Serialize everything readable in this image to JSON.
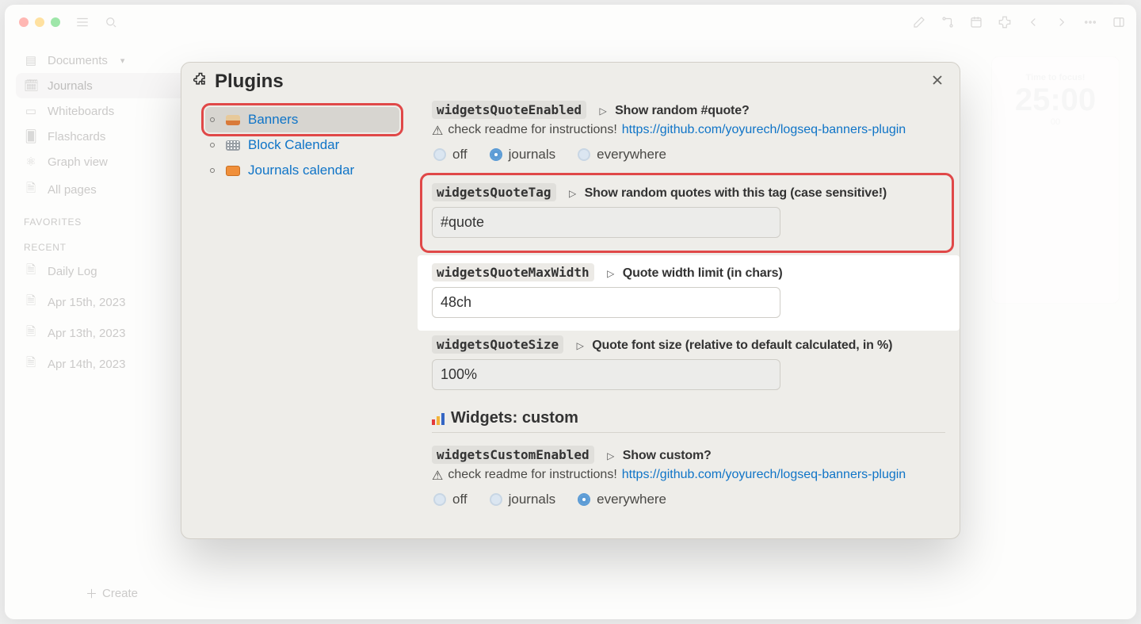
{
  "sidebar": {
    "nav": [
      {
        "label": "Documents",
        "icon": "book",
        "chev": true
      },
      {
        "label": "Journals",
        "icon": "calendar",
        "active": true
      },
      {
        "label": "Whiteboards",
        "icon": "whiteboard"
      },
      {
        "label": "Flashcards",
        "icon": "cards"
      },
      {
        "label": "Graph view",
        "icon": "graph"
      },
      {
        "label": "All pages",
        "icon": "pages"
      }
    ],
    "favorites_label": "FAVORITES",
    "recent_label": "RECENT",
    "recent": [
      {
        "label": "Daily Log"
      },
      {
        "label": "Apr 15th, 2023"
      },
      {
        "label": "Apr 13th, 2023"
      },
      {
        "label": "Apr 14th, 2023"
      }
    ],
    "create_label": "Create"
  },
  "right_widget": {
    "line1": "Time to focus!",
    "big": "25:00",
    "line2": "00"
  },
  "modal": {
    "title": "Plugins",
    "plugins": [
      {
        "label": "Banners",
        "color1": "#e7c99a",
        "color2": "#d97a3a",
        "selected": true
      },
      {
        "label": "Block Calendar",
        "calendar": true
      },
      {
        "label": "Journals calendar",
        "cal_orange": true
      }
    ],
    "quoteEnabled": {
      "code": "widgetsQuoteEnabled",
      "desc": "Show random #quote?",
      "warn_prefix": "check readme for instructions!",
      "link": "https://github.com/yoyurech/logseq-banners-plugin",
      "options": [
        "off",
        "journals",
        "everywhere"
      ],
      "selected": "journals"
    },
    "quoteTag": {
      "code": "widgetsQuoteTag",
      "desc": "Show random quotes with this tag (case sensitive!)",
      "value": "#quote"
    },
    "quoteMaxWidth": {
      "code": "widgetsQuoteMaxWidth",
      "desc": "Quote width limit (in chars)",
      "value": "48ch"
    },
    "quoteSize": {
      "code": "widgetsQuoteSize",
      "desc": "Quote font size (relative to default calculated, in %)",
      "value": "100%"
    },
    "widgetsHeader": "Widgets: custom",
    "customEnabled": {
      "code": "widgetsCustomEnabled",
      "desc": "Show custom?",
      "warn_prefix": "check readme for instructions!",
      "link": "https://github.com/yoyurech/logseq-banners-plugin",
      "options": [
        "off",
        "journals",
        "everywhere"
      ],
      "selected": "everywhere"
    }
  }
}
